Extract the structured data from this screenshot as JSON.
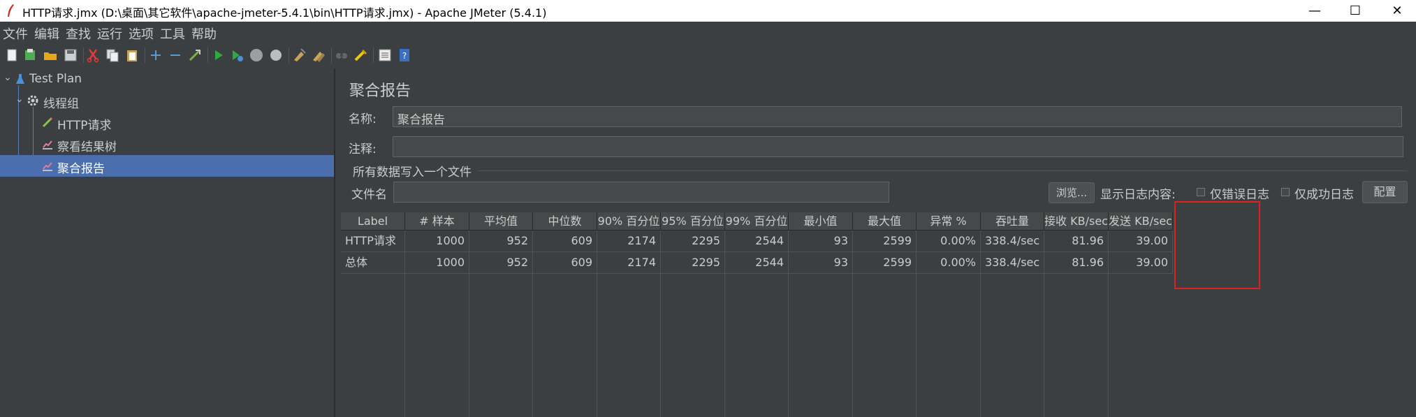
{
  "window": {
    "title": "HTTP请求.jmx (D:\\桌面\\其它软件\\apache-jmeter-5.4.1\\bin\\HTTP请求.jmx) - Apache JMeter (5.4.1)",
    "minimize": "—",
    "maximize": "☐",
    "close": "✕"
  },
  "menu": [
    "文件",
    "编辑",
    "查找",
    "运行",
    "选项",
    "工具",
    "帮助"
  ],
  "tree": {
    "test_plan": "Test Plan",
    "thread_group": "线程组",
    "http_request": "HTTP请求",
    "view_results_tree": "察看结果树",
    "aggregate_report": "聚合报告"
  },
  "panel": {
    "title": "聚合报告",
    "name_label": "名称:",
    "name_value": "聚合报告",
    "comment_label": "注释:",
    "comment_value": "",
    "file_group_title": "所有数据写入一个文件",
    "filename_label": "文件名",
    "filename_value": "",
    "browse_button": "浏览...",
    "log_content_label": "显示日志内容:",
    "errors_only_label": "仅错误日志",
    "success_only_label": "仅成功日志",
    "configure_button": "配置"
  },
  "table": {
    "headers": [
      "Label",
      "# 样本",
      "平均值",
      "中位数",
      "90% 百分位",
      "95% 百分位",
      "99% 百分位",
      "最小值",
      "最大值",
      "异常 %",
      "吞吐量",
      "接收 KB/sec",
      "发送 KB/sec"
    ],
    "rows": [
      [
        "HTTP请求",
        "1000",
        "952",
        "609",
        "2174",
        "2295",
        "2544",
        "93",
        "2599",
        "0.00%",
        "338.4/sec",
        "81.96",
        "39.00"
      ],
      [
        "总体",
        "1000",
        "952",
        "609",
        "2174",
        "2295",
        "2544",
        "93",
        "2599",
        "0.00%",
        "338.4/sec",
        "81.96",
        "39.00"
      ]
    ]
  },
  "colors": {
    "background": "#3c3f41",
    "selection": "#4b6eaf",
    "highlight_box": "#e0201c"
  }
}
